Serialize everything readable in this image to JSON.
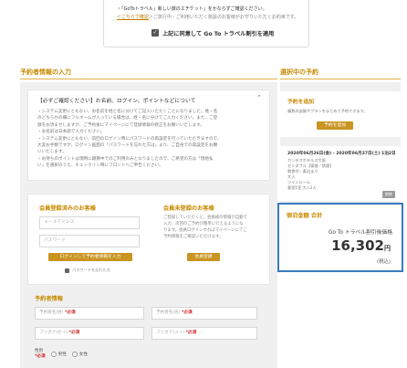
{
  "notice": {
    "line1": "・「GoToトラベル」新しい旅のエチケット」をかならずご確認ください。",
    "line2_link": "＜こちらで確認",
    "line2_rest": "＞ご旅行中・ご利用いただく施設のお客様がお守りいただくお約束です。",
    "agree_label": "上記に同意して Go To トラベル割引を適用",
    "check_mark": "✓"
  },
  "booker_section": {
    "title": "予約者情報の入力"
  },
  "selected_section": {
    "title": "選択中の予約"
  },
  "confirm": {
    "title": "【必ずご確認ください】お名前、ログイン、ポイントなどについて",
    "toggle": "⌃",
    "lines": [
      "・システム変更にともない、お名前を姓と名に分けてご記入いただくことになりました。姓・名",
      "のどちらかの欄にフルネームが入っている場合は、姓・名に分けてご入力ください。また、ご登",
      "録をお済ませしますが、ご予約後にマイページにて登録情報の修正をお願いいたします。",
      "・お名前は日本語で入力ください。",
      "・システム変更にともない、前回のログイン時にパスワードの再設定を行っていただきますので、",
      "大変お手数ですが、ログイン画面の「パスワードを忘れた方は」より、ご自身での再設定をお願",
      "いいたします。",
      "・お持ちのポイントは現時に期算中でのご利用のみとなりましたので、ご希望の方は「現地払",
      "い」を選択のうえ、チェックイン時にフロントへご申告ください。"
    ]
  },
  "login": {
    "member_title": "会員登録済みのお客様",
    "email_placeholder": "メールアドレス",
    "password_placeholder": "パスワード",
    "login_button": "ログインして予約者情報を入力",
    "forgot_password": "パスワードを忘れた方",
    "guest_title": "会員未登録のお客様",
    "guest_text": "ご登録していただくと、会員様の情報が自動で入力、次回のご予約が簡単に行えるようになります。会員ログインすればマイページにてご予約情報をご確認いただけます。",
    "register_button": "会員登録"
  },
  "booker": {
    "title": "予約者情報",
    "last_name": "予約者名(姓)",
    "first_name": "予約者名(名)",
    "last_kana": "フリガナ(セイ)",
    "first_kana": "フリガナ(メイ)",
    "required": "*必須",
    "gender_label": "性別",
    "gender_required": "*必須",
    "male": "男性",
    "female": "女性"
  },
  "add_plan": {
    "title": "予約を追加",
    "text": "複数の部屋やプランをまとめて予約できます。",
    "button": "予約を追加"
  },
  "trip": {
    "dates": "2020年06月26日(金) - 2020年06月27日(土) 1泊2日",
    "lines": [
      "カンデオホテルズ大阪",
      "セミダブル【喫煙／禁煙】",
      "朝食付・素泊まり",
      "大人",
      "ツインルーム",
      "客室1室 大人2人"
    ],
    "tag": "削除"
  },
  "total": {
    "head": "宿泊金額 合計",
    "discount_label": "Go To トラベル割引後価格",
    "amount": "16,302",
    "yen": "円",
    "tax": "(税込)"
  }
}
